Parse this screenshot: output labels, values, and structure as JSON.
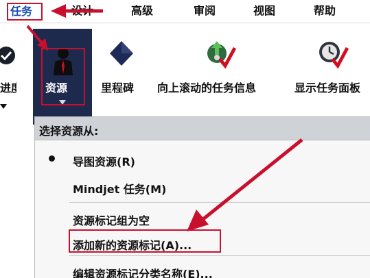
{
  "tabs": {
    "task": "任务",
    "design": "设计",
    "advanced": "高级",
    "review": "审阅",
    "view": "视图",
    "help": "帮助"
  },
  "ribbon": {
    "progress_label": "进度",
    "resource_label": "资源",
    "milestone_label": "里程碑",
    "scroll_label": "向上滚动的任务信息",
    "panel_label": "显示任务面板",
    "icons": [
      "progress-check-icon",
      "resource-person-icon",
      "milestone-diamond-icon",
      "scroll-task-info-icon",
      "task-panel-clock-icon"
    ]
  },
  "menu": {
    "header": "选择资源从:",
    "items": [
      {
        "label": "导图资源(R)",
        "checked": true
      },
      {
        "label": "Mindjet 任务(M)",
        "checked": false
      },
      {
        "label": "资源标记组为空",
        "checked": false
      },
      {
        "label": "添加新的资源标记(A)...",
        "checked": false
      },
      {
        "label": "编辑资源标记分类名称(E)...",
        "checked": false
      }
    ]
  },
  "colors": {
    "highlight_red": "#c8102e",
    "selected_button_bg": "#1e2a4d",
    "active_tab_text": "#1a4fb5",
    "menu_header_bg": "#cfd3d8",
    "menu_bg": "#f7f7f7"
  }
}
